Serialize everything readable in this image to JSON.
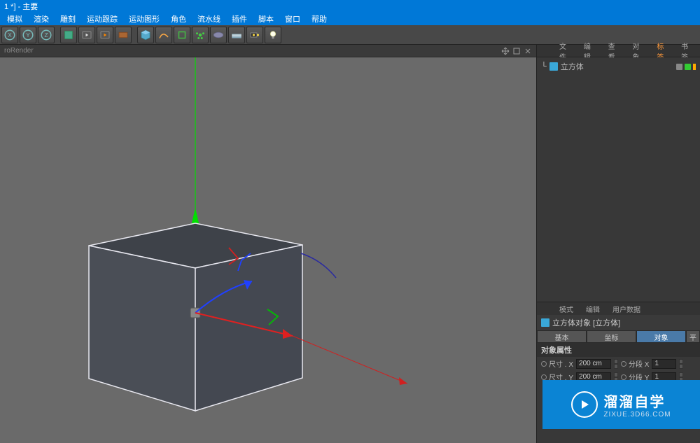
{
  "title": "1 *] - 主要",
  "menu": [
    "模拟",
    "渲染",
    "雕刻",
    "运动跟踪",
    "运动图形",
    "角色",
    "流水线",
    "插件",
    "脚本",
    "窗口",
    "帮助"
  ],
  "viewport_label": "roRender",
  "object_panel": {
    "tabs": [
      "文件",
      "编辑",
      "查看",
      "对象",
      "标签",
      "书签"
    ],
    "active_tab_index": 4,
    "tree": [
      {
        "name": "立方体",
        "icon": "cube"
      }
    ]
  },
  "attr_panel": {
    "tabs": [
      "模式",
      "编辑",
      "用户数据"
    ],
    "header": "立方体对象 [立方体]",
    "prop_tabs": [
      "基本",
      "坐标",
      "对象",
      "平"
    ],
    "prop_tabs_active": 2,
    "section": "对象属性",
    "rows": [
      {
        "label": "尺寸 . X",
        "value": "200 cm",
        "label2": "分段 X",
        "value2": "1"
      },
      {
        "label": "尺寸 . Y",
        "value": "200 cm",
        "label2": "分段 Y",
        "value2": "1"
      }
    ]
  },
  "watermark": {
    "big": "溜溜自学",
    "small": "ZIXUE.3D66.COM"
  },
  "colors": {
    "accent": "#0078d7",
    "tab_active": "#4a7aa8",
    "orange": "#ff9a3c"
  }
}
